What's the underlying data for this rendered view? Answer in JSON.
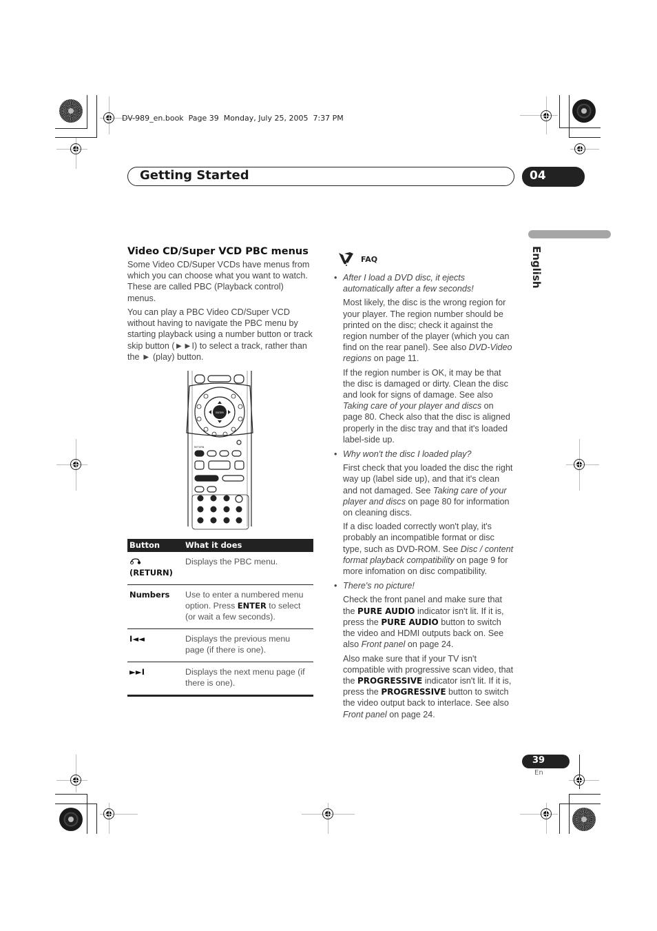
{
  "book_info": "DV-989_en.book  Page 39  Monday, July 25, 2005  7:37 PM",
  "header": {
    "title": "Getting Started",
    "chapter": "04"
  },
  "language_tab": "English",
  "left": {
    "heading": "Video CD/Super VCD PBC menus",
    "para1": "Some Video CD/Super VCDs have menus from which you can choose what you want to watch. These are called PBC (Playback control) menus.",
    "para2": "You can play a PBC Video CD/Super VCD without having to navigate the PBC menu by starting playback using a number button or track skip button (►►I) to select a track, rather than the ► (play) button.",
    "remote_labels": {
      "enter": "ENTER",
      "return": "RETURN"
    },
    "table": {
      "headers": [
        "Button",
        "What it does"
      ],
      "rows": [
        {
          "button_icon": "return-icon",
          "button": "(RETURN)",
          "desc": "Displays the PBC menu."
        },
        {
          "button": "Numbers",
          "desc_pre": "Use to enter a numbered menu option. Press ",
          "desc_bold": "ENTER",
          "desc_post": " to select (or wait a few seconds)."
        },
        {
          "button_icon": "previous-icon",
          "button": "I◄◄",
          "desc": "Displays the previous menu page (if there is one)."
        },
        {
          "button_icon": "next-icon",
          "button": "►►I",
          "desc": "Displays the next menu page (if there is one)."
        }
      ]
    }
  },
  "faq": {
    "label": "FAQ",
    "items": [
      {
        "question": "After I load a DVD disc, it ejects automatically after a few seconds!",
        "answers": [
          {
            "t1": "Most likely, the disc is the wrong region for your player. The region number should be printed on the disc; check it against the region number of the player (which you can find on the rear panel). See also ",
            "i1": "DVD-Video regions",
            "t2": " on page 11."
          },
          {
            "t1": "If the region number is OK, it may be that the disc is damaged or dirty. Clean the disc and look for signs of damage. See also ",
            "i1": "Taking care of your player and discs",
            "t2": " on page 80. Check also that the disc is aligned properly in the disc tray and that it's loaded label-side up."
          }
        ]
      },
      {
        "question": "Why won't the disc I loaded play?",
        "answers": [
          {
            "t1": "First check that you loaded the disc the right way up (label side up), and that it's clean and not damaged. See ",
            "i1": "Taking care of your player and discs",
            "t2": " on page 80 for information on cleaning discs."
          },
          {
            "t1": "If a disc loaded correctly won't play, it's probably an incompatible format or disc type, such as DVD-ROM. See ",
            "i1": "Disc / content format playback compatibility",
            "t2": " on page 9 for more infomation on disc compatibility."
          }
        ]
      },
      {
        "question": "There's no picture!",
        "answers": [
          {
            "t1": "Check the front panel and make sure that the ",
            "b1": "PURE AUDIO",
            "t2": " indicator isn't lit. If it is, press the ",
            "b2": "PURE AUDIO",
            "t3": " button to switch the video and HDMI outputs back on. See also ",
            "i1": "Front panel",
            "t4": " on page 24."
          },
          {
            "t1": "Also make sure that if your TV isn't compatible with progressive scan video, that the ",
            "b1": "PROGRESSIVE",
            "t2": " indicator isn't lit. If it is, press the ",
            "b2": "PROGRESSIVE",
            "t3": " button to switch the video output back to interlace. See also ",
            "i1": "Front panel",
            "t4": " on page 24."
          }
        ]
      }
    ]
  },
  "footer": {
    "page_number": "39",
    "page_lang": "En"
  }
}
